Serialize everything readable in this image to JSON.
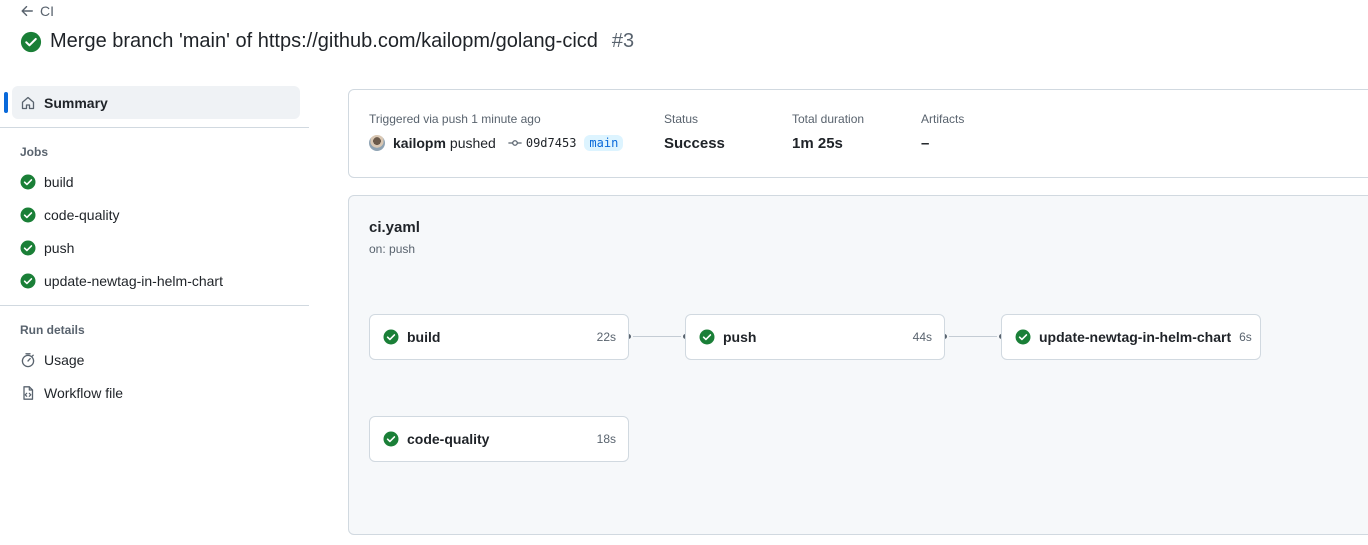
{
  "header": {
    "back_label": "CI",
    "title": "Merge branch 'main' of https://github.com/kailopm/golang-cicd",
    "run_number": "#3"
  },
  "sidebar": {
    "summary_label": "Summary",
    "jobs_section": "Jobs",
    "jobs": [
      {
        "label": "build",
        "status": "success"
      },
      {
        "label": "code-quality",
        "status": "success"
      },
      {
        "label": "push",
        "status": "success"
      },
      {
        "label": "update-newtag-in-helm-chart",
        "status": "success"
      }
    ],
    "run_details_section": "Run details",
    "run_details": [
      {
        "label": "Usage",
        "icon": "stopwatch-icon"
      },
      {
        "label": "Workflow file",
        "icon": "file-code-icon"
      }
    ]
  },
  "summary": {
    "trigger_label": "Triggered via push 1 minute ago",
    "actor": "kailopm",
    "action": "pushed",
    "commit": "09d7453",
    "branch": "main",
    "status_label": "Status",
    "status_value": "Success",
    "duration_label": "Total duration",
    "duration_value": "1m 25s",
    "artifacts_label": "Artifacts",
    "artifacts_value": "–"
  },
  "workflow": {
    "file": "ci.yaml",
    "trigger": "on: push",
    "jobs": [
      {
        "name": "build",
        "duration": "22s"
      },
      {
        "name": "push",
        "duration": "44s"
      },
      {
        "name": "update-newtag-in-helm-chart",
        "duration": "6s"
      },
      {
        "name": "code-quality",
        "duration": "18s"
      }
    ]
  },
  "colors": {
    "success": "#1a7f37",
    "accent": "#0969da"
  }
}
